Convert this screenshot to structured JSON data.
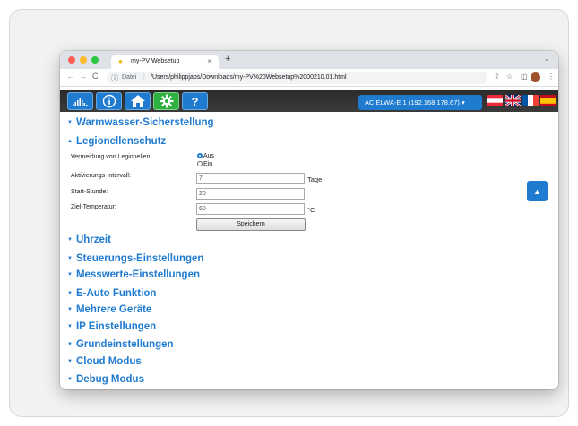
{
  "browser": {
    "tab_title": "my-PV Websetup",
    "tab_close": "×",
    "new_tab": "+",
    "tab_menu": "⌄",
    "omnibox_label": "Datei",
    "url": "/Users/philippjabs/Downloads/my-PV%20Websetup%2000210.01.html",
    "back": "←",
    "forward": "→",
    "reload": "C",
    "colors": {
      "close": "#ff5f57",
      "minimize": "#febc2e",
      "maximize": "#28c840"
    }
  },
  "nav": {
    "icons": [
      "chart-icon",
      "info-icon",
      "home-icon",
      "gear-icon",
      "help-icon"
    ],
    "help_label": "?",
    "device_select": "AC ELWA-E 1 (192.168.178.67) ▾"
  },
  "flags": [
    "austria",
    "united-kingdom",
    "france",
    "spain"
  ],
  "sections": {
    "warmwasser": "Warmwasser-Sicherstellung",
    "legionellen": "Legionellenschutz",
    "uhrzeit": "Uhrzeit",
    "steuerung": "Steuerungs-Einstellungen",
    "messwerte": "Messwerte-Einstellungen",
    "eauto": "E-Auto Funktion",
    "mehrere": "Mehrere Geräte",
    "ip": "IP Einstellungen",
    "grund": "Grundeinstellungen",
    "cloud": "Cloud Modus",
    "debug": "Debug Modus"
  },
  "legionellen_form": {
    "vermeidung_label": "Vermeidung von Legionellen:",
    "option_aus": "Aus",
    "option_ein": "Ein",
    "selected": "Aus",
    "intervall_label": "Aktivierungs-Intervall:",
    "intervall_value": "7",
    "intervall_unit": "Tage",
    "startstunde_label": "Start-Stunde:",
    "startstunde_value": "20",
    "ziel_label": "Ziel-Temperatur:",
    "ziel_value": "60",
    "ziel_unit": "°C",
    "save_label": "Speichern"
  },
  "accent_color": "#1f7bd0"
}
